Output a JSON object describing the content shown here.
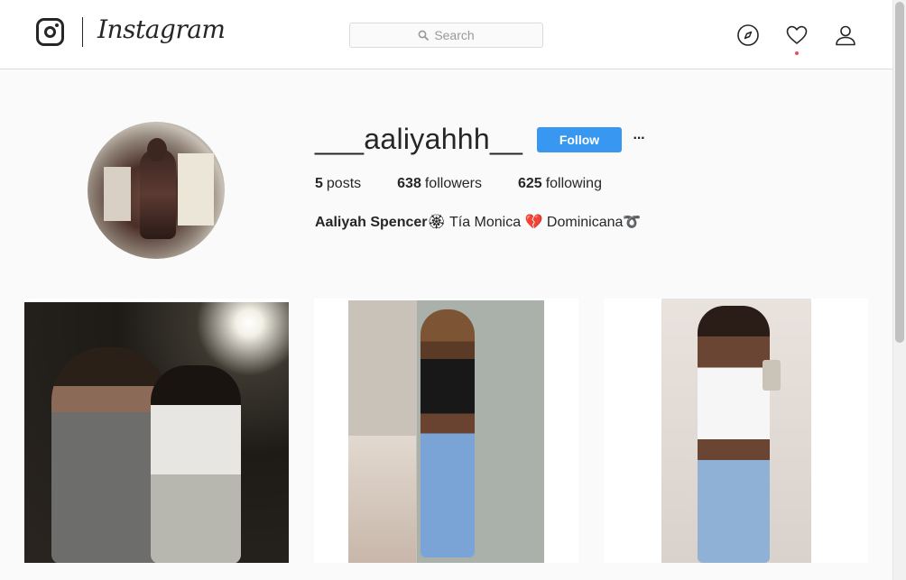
{
  "header": {
    "logo_text": "Instagram",
    "search": {
      "placeholder": "Search"
    },
    "icons": [
      "explore-icon",
      "activity-heart-icon",
      "profile-icon"
    ],
    "notification_dot_color": "#ed4956"
  },
  "profile": {
    "username": "___aaliyahhh__",
    "follow_label": "Follow",
    "more_label": "···",
    "stats": {
      "posts_count": "5",
      "posts_label": "posts",
      "followers_count": "638",
      "followers_label": "followers",
      "following_count": "625",
      "following_label": "following"
    },
    "bio": {
      "full_name": "Aaliyah Spencer",
      "text": "🏵 Tía Monica 💔 Dominicana➰"
    }
  },
  "posts": [
    {
      "alt": "post-1"
    },
    {
      "alt": "post-2"
    },
    {
      "alt": "post-3"
    }
  ],
  "colors": {
    "accent": "#3897f0",
    "background": "#fafafa",
    "text": "#262626",
    "border": "#dbdbdb"
  }
}
